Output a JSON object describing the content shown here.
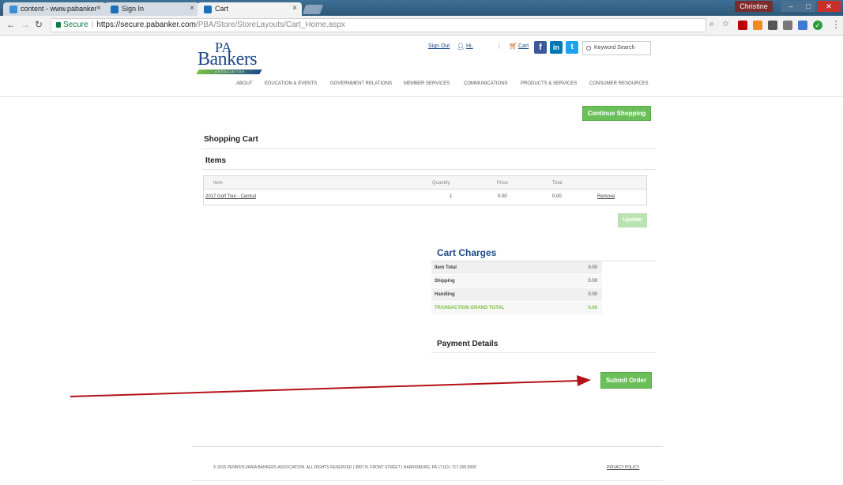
{
  "browser": {
    "tabs": [
      {
        "title": "content - www.pabanker",
        "color": "#3a8fd9"
      },
      {
        "title": "Sign In",
        "color": "#1d6fb8"
      },
      {
        "title": "Cart",
        "color": "#1d6fb8"
      }
    ],
    "profile_label": "Christine",
    "url": {
      "secure_label": "Secure",
      "host": "https://secure.pabanker.com",
      "path": "/PBA/Store/StoreLayouts/Cart_Home.aspx"
    }
  },
  "header": {
    "logo": {
      "line1": "PA",
      "line2": "Bankers",
      "tagline": "ASSOCIATION"
    },
    "sign_out": "Sign Out",
    "greeting": "Hi,",
    "cart_link": "Cart",
    "search_placeholder": "Keyword Search",
    "nav": [
      "ABOUT",
      "EDUCATION & EVENTS",
      "GOVERNMENT RELATIONS",
      "MEMBER SERVICES",
      "COMMUNICATIONS",
      "PRODUCTS & SERVICES",
      "CONSUMER RESOURCES"
    ]
  },
  "cart": {
    "continue_label": "Continue Shopping",
    "title": "Shopping Cart",
    "items_title": "Items",
    "columns": {
      "item": "Item",
      "quantity": "Quantity",
      "price": "Price",
      "total": "Total"
    },
    "items": [
      {
        "name": "2017 Golf Tour - Central",
        "quantity": "1",
        "price": "0.00",
        "total": "0.00",
        "remove": "Remove"
      }
    ],
    "update_label": "Update",
    "charges_title": "Cart Charges",
    "charges": [
      {
        "label": "Item Total",
        "value": "0.00"
      },
      {
        "label": "Shipping",
        "value": "0.00"
      },
      {
        "label": "Handling",
        "value": "0.00"
      },
      {
        "label": "TRANSACTION GRAND TOTAL",
        "value": "0.00"
      }
    ],
    "payment_title": "Payment Details",
    "submit_label": "Submit Order"
  },
  "footer": {
    "copyright": "© 2015 PENNSYLVANIA BANKERS ASSOCIATION. ALL RIGHTS RESERVED | 3897 N. FRONT STREET | HARRISBURG, PA 17110 | 717-255-5000",
    "privacy": "PRIVACY POLICY"
  },
  "colors": {
    "brand_blue": "#1d4a8a",
    "brand_green": "#7ac143",
    "button_green": "#6bbf59",
    "annotation_arrow": "#b3111a"
  }
}
